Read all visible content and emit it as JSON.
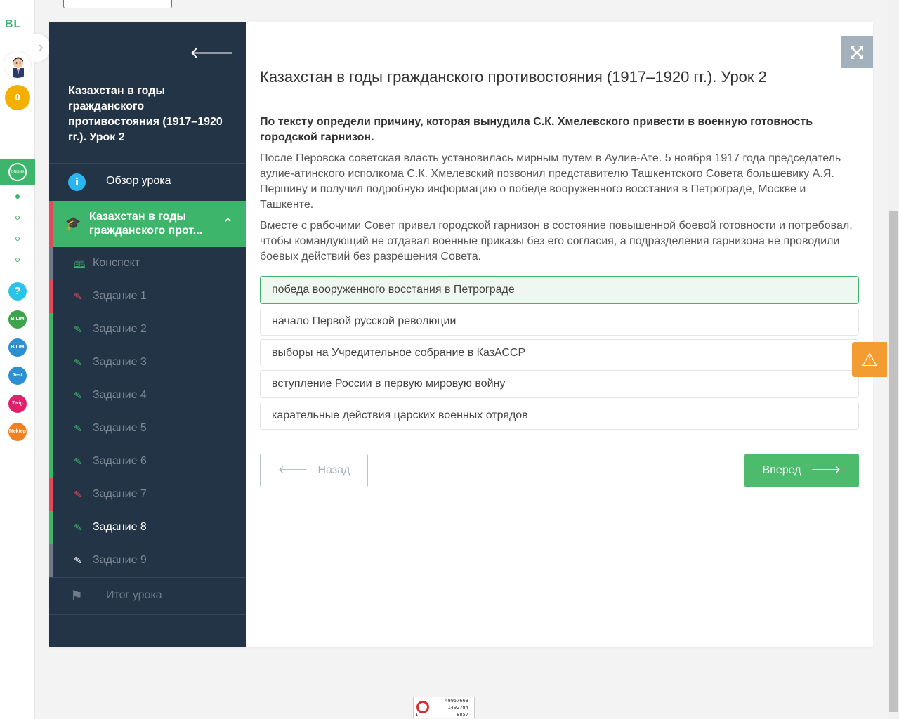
{
  "rail": {
    "logo": "BL",
    "coins": "0",
    "lesson_ring_text": "ONLINE MEKTEP",
    "apps": [
      {
        "label": "?",
        "color": "#2bc4e8",
        "icon": "help-icon"
      },
      {
        "label": "BILIM Land",
        "color": "#3fa34d",
        "icon": "bilimland-icon"
      },
      {
        "label": "BILIM Book",
        "color": "#2b8fd1",
        "icon": "bilimbook-icon"
      },
      {
        "label": "Test",
        "color": "#2b8fd1",
        "icon": "test-icon"
      },
      {
        "label": "Twig",
        "color": "#e0206a",
        "icon": "twig-icon"
      },
      {
        "label": "Mektep",
        "color": "#f08020",
        "icon": "mektep-icon"
      }
    ]
  },
  "sidebar": {
    "title": "Казахстан в годы гражданского противостояния (1917–1920 гг.). Урок 2",
    "overview_label": "Обзор урока",
    "lesson_label_line1": "Казахстан в годы",
    "lesson_label_line2": "гражданского прот...",
    "items": [
      {
        "label": "Конспект",
        "state": "gray",
        "icon": "book-icon"
      },
      {
        "label": "Задание 1",
        "state": "red",
        "icon": "edit-icon"
      },
      {
        "label": "Задание 2",
        "state": "green",
        "icon": "edit-icon"
      },
      {
        "label": "Задание 3",
        "state": "green",
        "icon": "edit-icon"
      },
      {
        "label": "Задание 4",
        "state": "green",
        "icon": "edit-icon"
      },
      {
        "label": "Задание 5",
        "state": "green",
        "icon": "edit-icon"
      },
      {
        "label": "Задание 6",
        "state": "green",
        "icon": "edit-icon"
      },
      {
        "label": "Задание 7",
        "state": "red",
        "icon": "edit-icon"
      },
      {
        "label": "Задание 8",
        "state": "current",
        "icon": "edit-icon"
      },
      {
        "label": "Задание 9",
        "state": "gray",
        "icon": "edit-icon"
      }
    ],
    "summary_label": "Итог урока"
  },
  "content": {
    "lesson_title": "Казахстан в годы гражданского противостояния (1917–1920 гг.). Урок 2",
    "question": "По тексту определи причину, которая вынудила С.К. Хмелевского привести в военную готовность городской гарнизон.",
    "paragraph1": "После Перовска советская власть установилась мирным путем в Аулие-Ате. 5 ноября 1917 года председатель аулие-атинского исполкома С.К. Хмелевский позвонил представителю Ташкентского Совета большевику А.Я. Першину и получил подробную информацию о победе вооруженного восстания в Петрограде, Москве и Ташкенте.",
    "paragraph2": "Вместе с рабочими Совет привел городской гарнизон в состояние повышенной боевой готовности и потребовал, чтобы командующий не отдавал военные приказы без его согласия, а подразделения гарнизона не проводили боевых действий без разрешения Совета.",
    "answers": [
      {
        "text": "победа вооруженного восстания в Петрограде",
        "selected": true
      },
      {
        "text": "начало Первой русской революции",
        "selected": false
      },
      {
        "text": "выборы на Учредительное собрание в КазАССР",
        "selected": false
      },
      {
        "text": "вступление России в первую мировую войну",
        "selected": false
      },
      {
        "text": "карательные действия царских военных отрядов",
        "selected": false
      }
    ],
    "back_label": "Назад",
    "next_label": "Вперед"
  },
  "counter": {
    "line1": "49957663",
    "line2": "1492784",
    "line3": "8857",
    "rank": "1"
  },
  "colors": {
    "accent_green": "#3db56b",
    "sidebar_bg": "#243447",
    "error_red": "#e04a5a",
    "warning_orange": "#f39c32"
  }
}
